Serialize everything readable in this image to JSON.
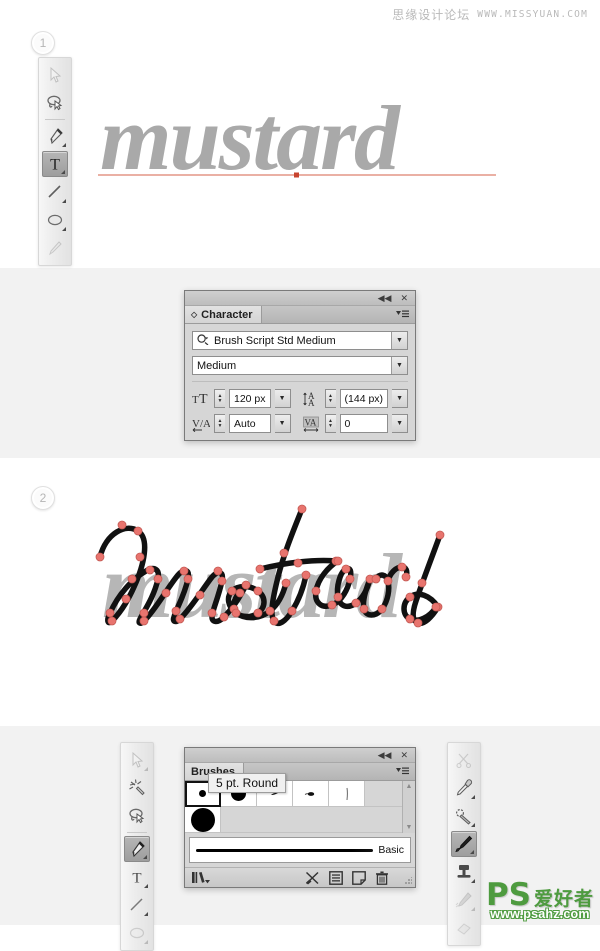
{
  "watermark": {
    "cn": "思缘设计论坛",
    "url": "WWW.MISSYUAN.COM"
  },
  "steps": [
    {
      "number": "1"
    },
    {
      "number": "2"
    }
  ],
  "artwork": {
    "word": "mustard",
    "step1_caption": "mustard",
    "step2_caption": "mustard",
    "text_color": "#a9a9a9",
    "baseline_color": "#d4604a",
    "anchor_color": "#e8746e",
    "path_color": "#111111"
  },
  "toolbars": {
    "top": {
      "items": [
        {
          "name": "direct-selection-tool",
          "label": "Direct Selection Tool",
          "selected": false,
          "faded": true
        },
        {
          "name": "lasso-tool",
          "label": "Lasso Tool",
          "selected": false
        },
        {
          "name": "pen-tool",
          "label": "Pen Tool",
          "selected": false
        },
        {
          "name": "type-tool",
          "label": "Type Tool",
          "selected": true
        },
        {
          "name": "line-segment-tool",
          "label": "Line Segment Tool",
          "selected": false
        },
        {
          "name": "ellipse-tool",
          "label": "Ellipse Tool",
          "selected": false
        },
        {
          "name": "paintbrush-tool",
          "label": "Paintbrush Tool",
          "selected": false,
          "faded": true
        }
      ]
    },
    "bottom_left": {
      "items": [
        {
          "name": "direct-selection-tool",
          "label": "Direct Selection Tool",
          "selected": false,
          "faded": true
        },
        {
          "name": "magic-wand-tool",
          "label": "Magic Wand Tool",
          "selected": false
        },
        {
          "name": "lasso-tool",
          "label": "Lasso Tool",
          "selected": false
        },
        {
          "name": "pen-tool",
          "label": "Pen Tool",
          "selected": true
        },
        {
          "name": "type-tool",
          "label": "Type Tool",
          "selected": false
        },
        {
          "name": "line-segment-tool",
          "label": "Line Segment Tool",
          "selected": false
        },
        {
          "name": "ellipse-tool",
          "label": "Ellipse Tool",
          "selected": false,
          "faded": true
        }
      ]
    },
    "bottom_right": {
      "items": [
        {
          "name": "scissors-tool",
          "label": "Scissors Tool",
          "selected": false,
          "faded": true
        },
        {
          "name": "eyedropper-tool",
          "label": "Eyedropper Tool",
          "selected": false
        },
        {
          "name": "blend-tool",
          "label": "Blend Tool",
          "selected": false
        },
        {
          "name": "paintbrush-tool",
          "label": "Paintbrush Tool",
          "selected": true
        },
        {
          "name": "symbol-sprayer-tool",
          "label": "Symbol Sprayer Tool",
          "selected": false
        },
        {
          "name": "blob-brush-tool",
          "label": "Blob Brush Tool",
          "selected": false,
          "faded": true
        },
        {
          "name": "eraser-tool",
          "label": "Eraser Tool",
          "selected": false,
          "faded": true
        }
      ]
    }
  },
  "character_panel": {
    "tab_label": "Character",
    "collapse_icon": "◀◀",
    "close_icon": "✕",
    "menu_icon": "≡",
    "font_family": {
      "label": "Font Family",
      "value": "Brush Script Std Medium",
      "search_icon": "search-icon"
    },
    "font_style": {
      "label": "Font Style",
      "value": "Medium"
    },
    "font_size": {
      "label": "Font Size",
      "icon_label": "tT",
      "value": "120 px"
    },
    "leading": {
      "label": "Leading",
      "icon_label": "A/A",
      "value": "(144 px)"
    },
    "kerning": {
      "label": "Kerning",
      "icon_label": "VA",
      "value": "Auto"
    },
    "tracking": {
      "label": "Tracking",
      "icon_label": "VA",
      "value": "0"
    }
  },
  "brushes_panel": {
    "tab_label": "Brushes",
    "collapse_icon": "◀◀",
    "close_icon": "✕",
    "menu_icon": "≡",
    "tooltip": "5 pt. Round",
    "swatches_row1": [
      {
        "name": "brush-5pt-round",
        "kind": "dot",
        "size": 7,
        "selected": true
      },
      {
        "name": "brush-large-round",
        "kind": "dot",
        "size": 15,
        "selected": false
      },
      {
        "name": "brush-tiny-mark",
        "kind": "mark-small",
        "size": 4,
        "selected": false
      },
      {
        "name": "brush-oval-mark",
        "kind": "mark-oval",
        "size": 6,
        "selected": false
      },
      {
        "name": "brush-thin-stroke",
        "kind": "stroke-thin",
        "size": 10,
        "selected": false
      }
    ],
    "swatches_row2": [
      {
        "name": "brush-xlarge-round",
        "kind": "dot",
        "size": 24,
        "selected": false
      }
    ],
    "stroke_preview": {
      "label": "Basic"
    },
    "footer": {
      "library_label": "Brush Libraries Menu",
      "remove_stroke_label": "Remove Brush Stroke",
      "options_label": "Options of Selected Object",
      "new_brush_label": "New Brush",
      "delete_label": "Delete Brush"
    }
  },
  "ps_logo": {
    "mark": "PS",
    "cn": "爱好者",
    "url": "www.psahz.com",
    "color": "#4e9b3f"
  }
}
